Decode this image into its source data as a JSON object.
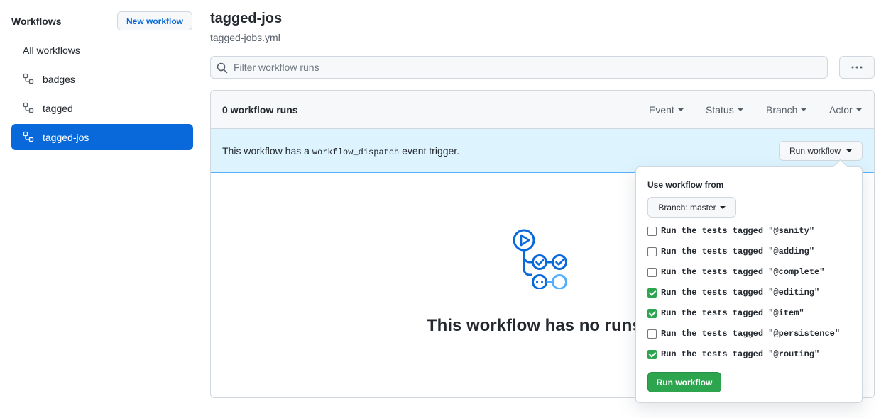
{
  "sidebar": {
    "title": "Workflows",
    "new_button": "New workflow",
    "items": [
      {
        "label": "All workflows",
        "icon": "none",
        "active": false
      },
      {
        "label": "badges",
        "icon": "workflow-icon",
        "active": false
      },
      {
        "label": "tagged",
        "icon": "workflow-icon",
        "active": false
      },
      {
        "label": "tagged-jos",
        "icon": "workflow-icon",
        "active": true
      }
    ]
  },
  "header": {
    "title": "tagged-jos",
    "subtitle": "tagged-jobs.yml"
  },
  "search": {
    "placeholder": "Filter workflow runs",
    "value": ""
  },
  "runs": {
    "count_label": "0 workflow runs",
    "filters": [
      "Event",
      "Status",
      "Branch",
      "Actor"
    ]
  },
  "dispatch": {
    "text_before": "This workflow has a ",
    "code": "workflow_dispatch",
    "text_after": " event trigger.",
    "run_button": "Run workflow"
  },
  "empty": {
    "text": "This workflow has no runs y"
  },
  "popover": {
    "label": "Use workflow from",
    "branch_button": "Branch: master",
    "options": [
      {
        "label": "Run the tests tagged \"@sanity\"",
        "checked": false
      },
      {
        "label": "Run the tests tagged \"@adding\"",
        "checked": false
      },
      {
        "label": "Run the tests tagged \"@complete\"",
        "checked": false
      },
      {
        "label": "Run the tests tagged \"@editing\"",
        "checked": true
      },
      {
        "label": "Run the tests tagged \"@item\"",
        "checked": true
      },
      {
        "label": "Run the tests tagged \"@persistence\"",
        "checked": false
      },
      {
        "label": "Run the tests tagged \"@routing\"",
        "checked": true
      }
    ],
    "submit_button": "Run workflow"
  },
  "colors": {
    "accent": "#0969da",
    "success": "#2da44e",
    "dispatch_bg": "#ddf4ff"
  }
}
